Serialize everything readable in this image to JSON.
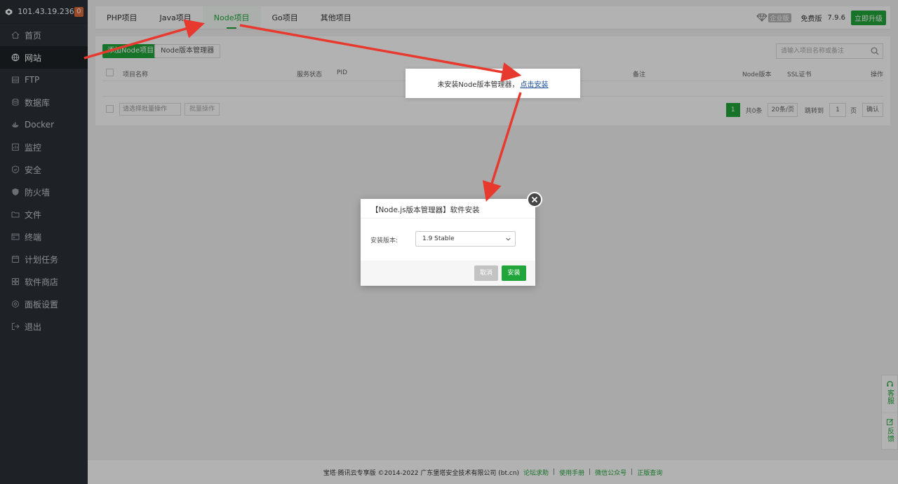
{
  "sidebar": {
    "ip": "101.43.19.236",
    "badge": "0",
    "items": [
      {
        "label": "首页",
        "icon": "home-icon"
      },
      {
        "label": "网站",
        "icon": "globe-icon"
      },
      {
        "label": "FTP",
        "icon": "ftp-icon"
      },
      {
        "label": "数据库",
        "icon": "database-icon"
      },
      {
        "label": "Docker",
        "icon": "docker-icon"
      },
      {
        "label": "监控",
        "icon": "monitor-icon"
      },
      {
        "label": "安全",
        "icon": "shield-icon"
      },
      {
        "label": "防火墙",
        "icon": "firewall-icon"
      },
      {
        "label": "文件",
        "icon": "folder-icon"
      },
      {
        "label": "终端",
        "icon": "terminal-icon"
      },
      {
        "label": "计划任务",
        "icon": "calendar-icon"
      },
      {
        "label": "软件商店",
        "icon": "apps-icon"
      },
      {
        "label": "面板设置",
        "icon": "settings-icon"
      },
      {
        "label": "退出",
        "icon": "logout-icon"
      }
    ]
  },
  "tabs": [
    "PHP项目",
    "Java项目",
    "Node项目",
    "Go项目",
    "其他项目"
  ],
  "header_right": {
    "enterprise": "企业版",
    "free": "免费版",
    "version": "7.9.6",
    "upgrade": "立即升级"
  },
  "toolbar": {
    "add_node": "添加Node项目",
    "version_manager": "Node版本管理器",
    "search_placeholder": "请输入项目名称或备注"
  },
  "table": {
    "headers": [
      "项目名称",
      "服务状态",
      "PID",
      "备注",
      "Node版本",
      "SSL证书",
      "操作"
    ]
  },
  "bulk": {
    "select_placeholder": "请选择批量操作",
    "button": "批量操作"
  },
  "pager": {
    "page": "1",
    "total": "共0条",
    "per_page": "20条/页",
    "jump_label": "跳转到",
    "jump_value": "1",
    "page_unit": "页",
    "confirm": "确认"
  },
  "tip": {
    "text": "未安装Node版本管理器，",
    "link": "点击安装"
  },
  "dialog": {
    "title": "【Node.js版本管理器】软件安装",
    "label": "安装版本:",
    "selected": "1.9 Stable",
    "cancel": "取消",
    "install": "安装"
  },
  "footer": {
    "copyright": "宝塔·腾讯云专享版 ©2014-2022 广东堡塔安全技术有限公司 (bt.cn)",
    "links": [
      "论坛求助",
      "使用手册",
      "微信公众号",
      "正版查询"
    ]
  },
  "float": {
    "service": "客服",
    "feedback": "反馈"
  },
  "colors": {
    "brand_green": "#20a53a",
    "sidebar_bg": "#2c3138",
    "arrow_red": "#e8392e"
  }
}
